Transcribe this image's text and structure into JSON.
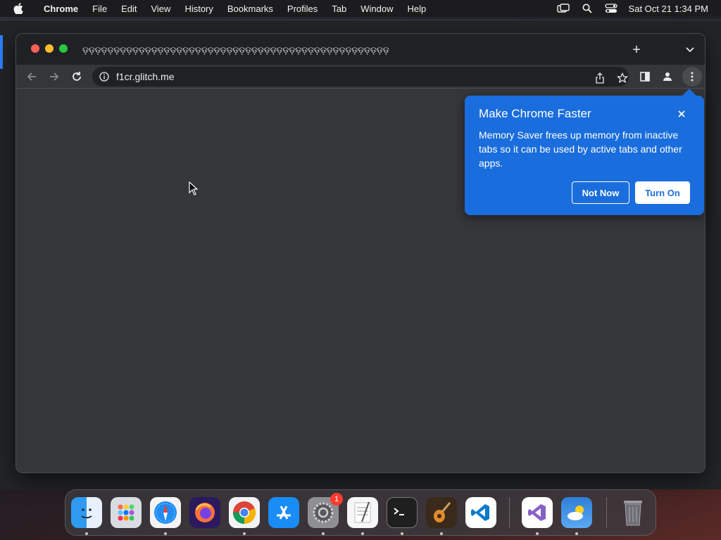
{
  "menubar": {
    "apple_icon": "apple-icon",
    "items": [
      "Chrome",
      "File",
      "Edit",
      "View",
      "History",
      "Bookmarks",
      "Profiles",
      "Tab",
      "Window",
      "Help"
    ],
    "status_icons": [
      "screen-mirroring-icon",
      "search-icon",
      "control-center-icon"
    ],
    "clock": "Sat Oct 21  1:34 PM"
  },
  "browser": {
    "tab_titles": "ଡ଼ଡ଼ଡ଼ଡ଼ଡ଼ଡ଼ଡ଼ଡ଼ଡ଼ଡ଼ଡ଼ଡ଼ଡ଼ଡ଼ଡ଼ଡ଼ଡ଼ଡ଼ଡ଼ଡ଼ଡ଼ଡ଼ଡ଼ଡ଼ଡ଼ଡ଼ଡ଼ଡ଼ଡ଼ଡ଼ଡ଼ଡ଼ଡ଼ଡ଼ଡ଼ଡ଼ଡ଼ଡ଼ଡ଼ଡ଼ଡ଼ଡ଼ଡ଼ଡ଼ଡ଼ଡ଼ଡ଼ଡ଼ଡ଼",
    "new_tab": "+",
    "url": "f1cr.glitch.me"
  },
  "bubble": {
    "title": "Make Chrome Faster",
    "body": "Memory Saver frees up memory from inactive tabs so it can be used by active tabs and other apps.",
    "not_now": "Not Now",
    "turn_on": "Turn On"
  },
  "dock": {
    "apps": [
      "Finder",
      "Launchpad",
      "Safari",
      "Firefox",
      "Chrome",
      "App Store",
      "System Settings",
      "TextEdit",
      "Terminal",
      "GarageBand",
      "Visual Studio Code",
      "Visual Studio",
      "Weather",
      "Trash"
    ],
    "settings_badge": "1"
  },
  "colors": {
    "bubble_bg": "#1a6ddc",
    "window_bg": "#35363a",
    "tabstrip_bg": "#202124"
  }
}
